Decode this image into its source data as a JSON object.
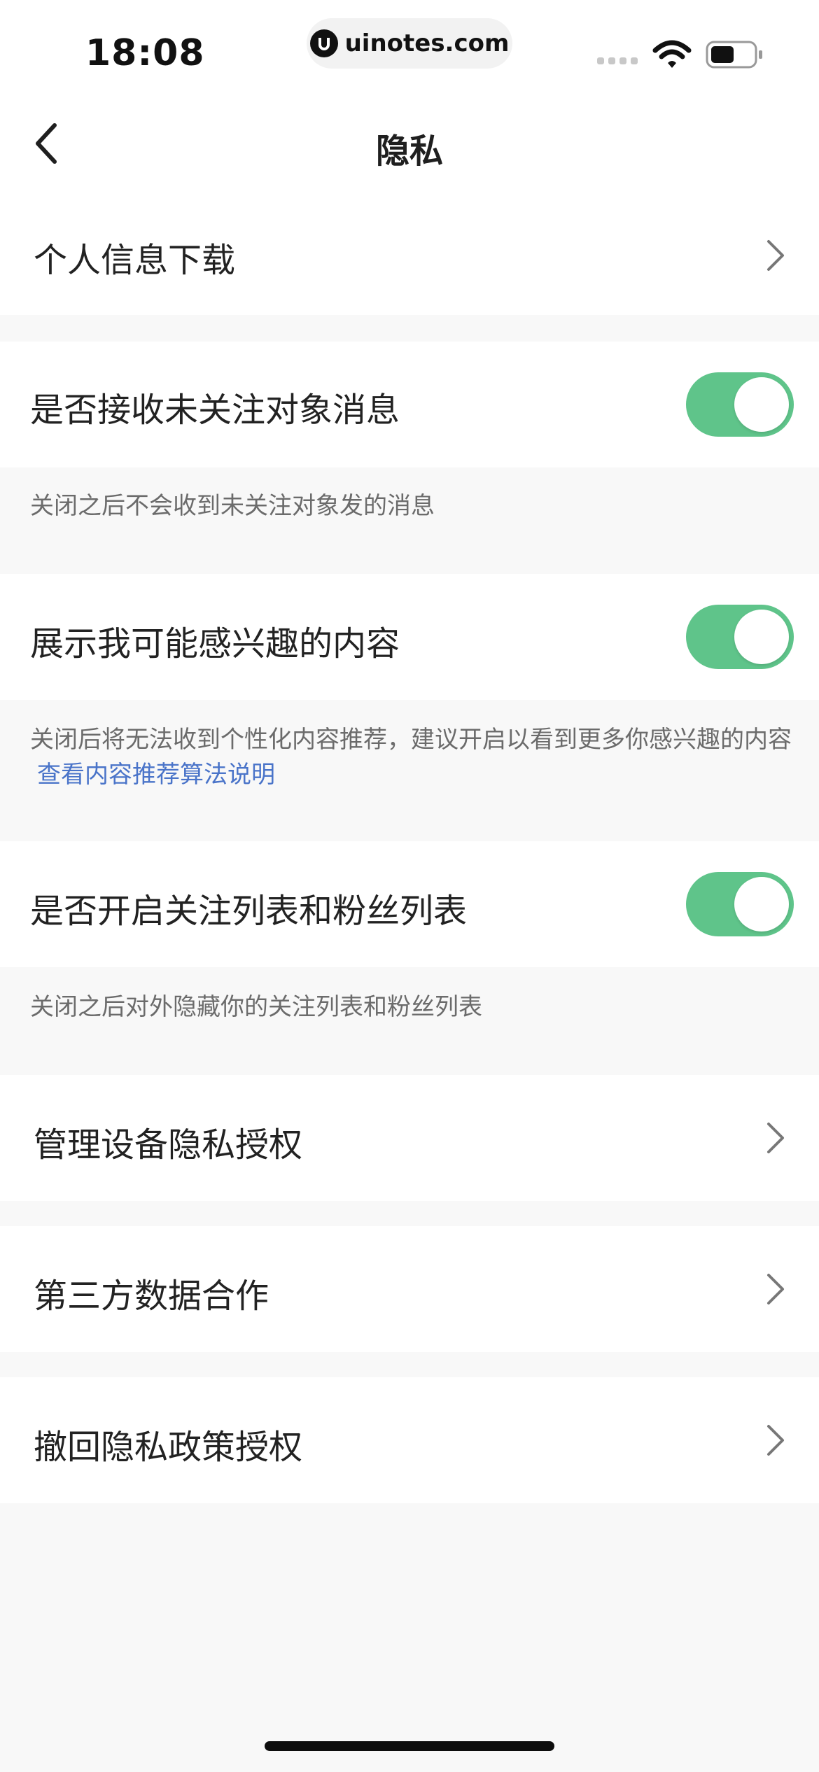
{
  "status_bar": {
    "time": "18:08",
    "url": "uinotes.com",
    "icons": [
      "signal-icon",
      "wifi-icon",
      "battery-icon"
    ]
  },
  "nav": {
    "back_icon": "chevron-left-icon",
    "title": "隐私"
  },
  "rows": {
    "personal_info_download": "个人信息下载",
    "receive_unfollowed_messages": "是否接收未关注对象消息",
    "show_interest_content": "展示我可能感兴趣的内容",
    "enable_follow_fan_lists": "是否开启关注列表和粉丝列表",
    "manage_device_privacy": "管理设备隐私授权",
    "third_party_data": "第三方数据合作",
    "revoke_privacy_policy": "撤回隐私政策授权"
  },
  "toggles": {
    "receive_unfollowed_messages": true,
    "show_interest_content": true,
    "enable_follow_fan_lists": true
  },
  "notes": {
    "receive_unfollowed_messages": "关闭之后不会收到未关注对象发的消息",
    "show_interest_content": "关闭后将无法收到个性化内容推荐，建议开启以看到更多你感兴趣的内容",
    "show_interest_content_link": "查看内容推荐算法说明",
    "enable_follow_fan_lists": "关闭之后对外隐藏你的关注列表和粉丝列表"
  },
  "colors": {
    "toggle_on": "#5fc48a",
    "link": "#4a74c9",
    "background": "#f8f8f8"
  }
}
